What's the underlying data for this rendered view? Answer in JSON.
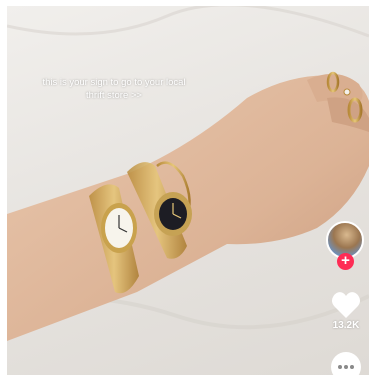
{
  "video": {
    "caption": "this is your sign to go to your local thrift store >>"
  },
  "actions": {
    "avatar_icon": "creator-avatar",
    "follow_icon": "plus-icon",
    "follow_symbol": "+",
    "like_icon": "heart-icon",
    "like_count": "13.2K",
    "more_icon": "ellipsis-icon"
  },
  "colors": {
    "follow_badge": "#fe2c55",
    "icon_fill": "#ffffff"
  }
}
